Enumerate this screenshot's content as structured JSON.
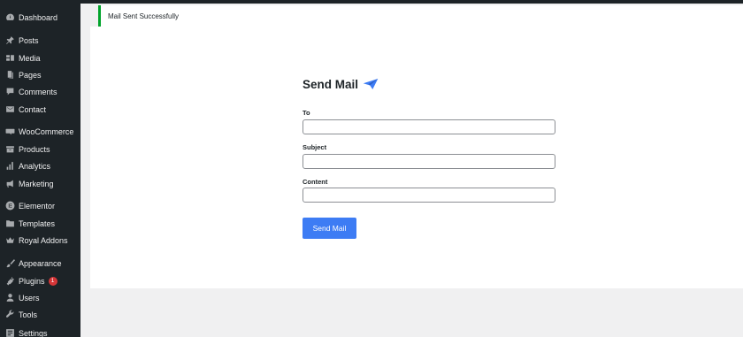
{
  "notice": {
    "message": "Mail Sent Successfully",
    "accent": "#00a32a"
  },
  "sidebar": {
    "items": [
      {
        "label": "Dashboard",
        "icon": "dashboard-icon"
      },
      {
        "label": "Posts",
        "icon": "pin-icon"
      },
      {
        "label": "Media",
        "icon": "media-icon"
      },
      {
        "label": "Pages",
        "icon": "pages-icon"
      },
      {
        "label": "Comments",
        "icon": "comment-icon"
      },
      {
        "label": "Contact",
        "icon": "mail-icon"
      },
      {
        "label": "WooCommerce",
        "icon": "woocommerce-icon"
      },
      {
        "label": "Products",
        "icon": "archive-icon"
      },
      {
        "label": "Analytics",
        "icon": "bar-chart-icon"
      },
      {
        "label": "Marketing",
        "icon": "megaphone-icon"
      },
      {
        "label": "Elementor",
        "icon": "elementor-icon"
      },
      {
        "label": "Templates",
        "icon": "folder-icon"
      },
      {
        "label": "Royal Addons",
        "icon": "crown-icon"
      },
      {
        "label": "Appearance",
        "icon": "brush-icon"
      },
      {
        "label": "Plugins",
        "icon": "plug-icon",
        "badge": "1"
      },
      {
        "label": "Users",
        "icon": "user-icon"
      },
      {
        "label": "Tools",
        "icon": "wrench-icon"
      },
      {
        "label": "Settings",
        "icon": "settings-icon"
      }
    ]
  },
  "form": {
    "title": "Send Mail",
    "title_icon": "paper-plane-icon",
    "fields": [
      {
        "label": "To",
        "value": ""
      },
      {
        "label": "Subject",
        "value": ""
      },
      {
        "label": "Content",
        "value": ""
      }
    ],
    "submit_label": "Send Mail",
    "accent": "#3d7cf4"
  }
}
